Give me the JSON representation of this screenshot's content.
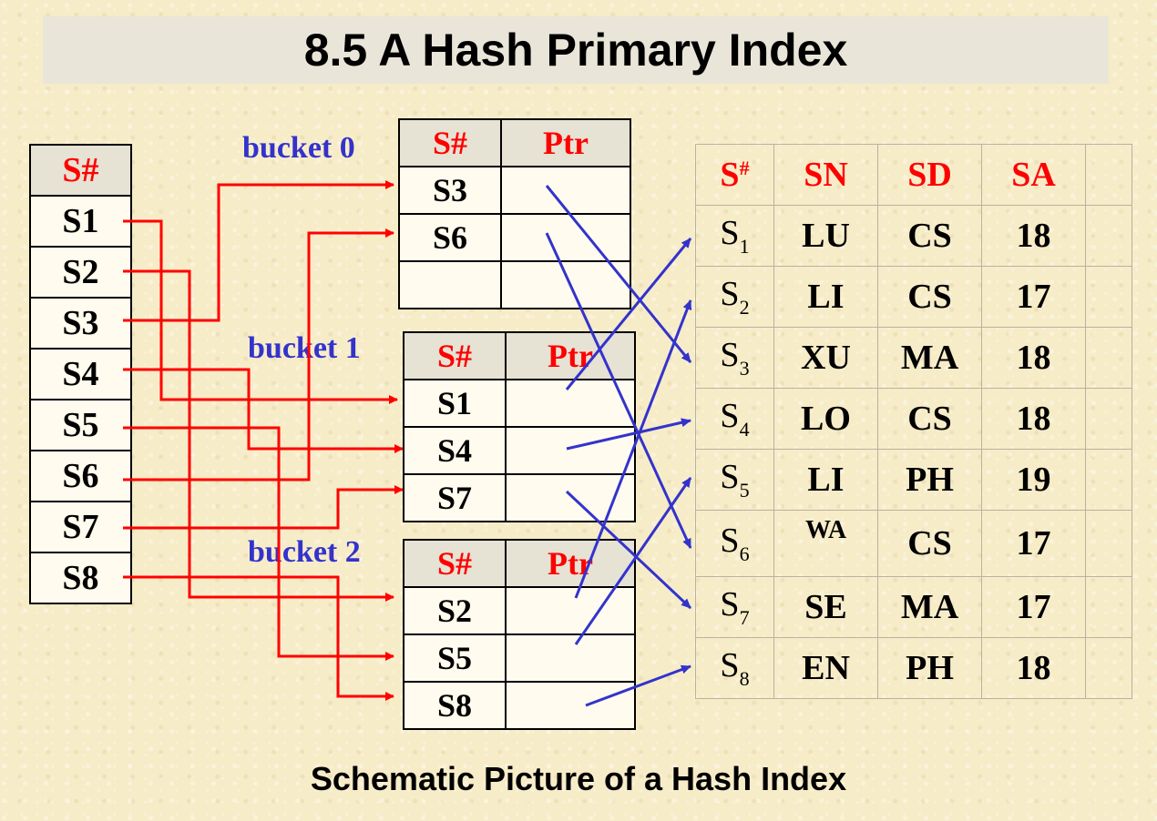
{
  "title": "8.5  A Hash Primary Index",
  "caption": "Schematic Picture of a Hash Index",
  "colors": {
    "header_text": "#ff0000",
    "bucket_label": "#3333cc",
    "red_arrow": "#ff0000",
    "blue_arrow": "#3333cc"
  },
  "index": {
    "header": "S#",
    "keys": [
      "S1",
      "S2",
      "S3",
      "S4",
      "S5",
      "S6",
      "S7",
      "S8"
    ]
  },
  "buckets": [
    {
      "label": "bucket 0",
      "key_header": "S#",
      "ptr_header": "Ptr",
      "keys": [
        "S3",
        "S6",
        ""
      ]
    },
    {
      "label": "bucket 1",
      "key_header": "S#",
      "ptr_header": "Ptr",
      "keys": [
        "S1",
        "S4",
        "S7"
      ]
    },
    {
      "label": "bucket 2",
      "key_header": "S#",
      "ptr_header": "Ptr",
      "keys": [
        "S2",
        "S5",
        "S8"
      ]
    }
  ],
  "relation": {
    "headers": {
      "sno_base": "S",
      "sno_sup": "#",
      "sn": "SN",
      "sd": "SD",
      "sa": "SA"
    },
    "rows": [
      {
        "sno_base": "S",
        "sno_sub": "1",
        "sn": "LU",
        "sd": "CS",
        "sa": "18"
      },
      {
        "sno_base": "S",
        "sno_sub": "2",
        "sn": "LI",
        "sd": "CS",
        "sa": "17"
      },
      {
        "sno_base": "S",
        "sno_sub": "3",
        "sn": "XU",
        "sd": "MA",
        "sa": "18"
      },
      {
        "sno_base": "S",
        "sno_sub": "4",
        "sn": "LO",
        "sd": "CS",
        "sa": "18"
      },
      {
        "sno_base": "S",
        "sno_sub": "5",
        "sn": "LI",
        "sd": "PH",
        "sa": "19"
      },
      {
        "sno_base": "S",
        "sno_sub": "6",
        "sn": "WA",
        "sd": "CS",
        "sa": "17"
      },
      {
        "sno_base": "S",
        "sno_sub": "7",
        "sn": "SE",
        "sd": "MA",
        "sa": "17"
      },
      {
        "sno_base": "S",
        "sno_sub": "8",
        "sn": "EN",
        "sd": "PH",
        "sa": "18"
      }
    ]
  }
}
